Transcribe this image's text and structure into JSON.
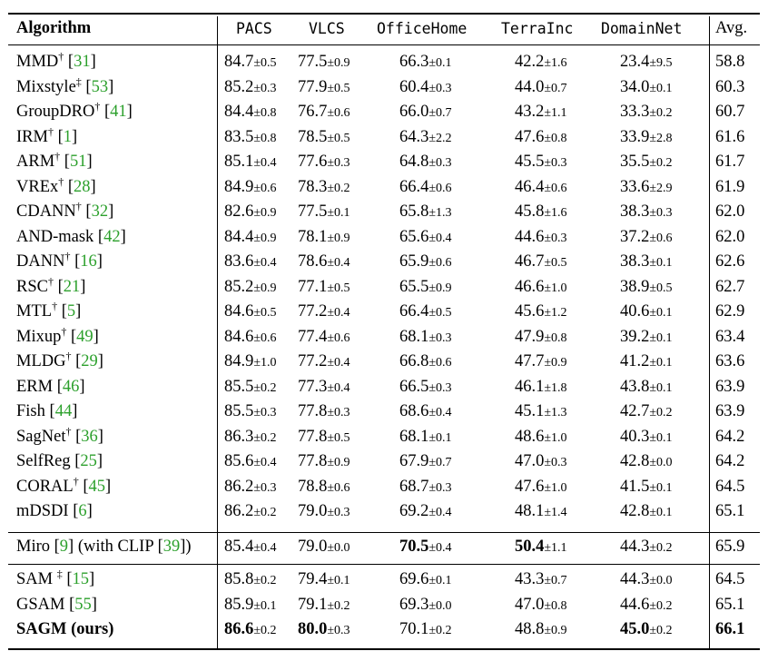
{
  "headers": {
    "algorithm": "Algorithm",
    "pacs": "PACS",
    "vlcs": "VLCS",
    "officehome": "OfficeHome",
    "terrainc": "TerraInc",
    "domainnet": "DomainNet",
    "avg": "Avg."
  },
  "rows": [
    {
      "name": "MMD",
      "sup": "†",
      "ref": "31",
      "pacs": [
        "84.7",
        "±0.5"
      ],
      "vlcs": [
        "77.5",
        "±0.9"
      ],
      "officehome": [
        "66.3",
        "±0.1"
      ],
      "terrainc": [
        "42.2",
        "±1.6"
      ],
      "domainnet": [
        "23.4",
        "±9.5"
      ],
      "avg": "58.8"
    },
    {
      "name": "Mixstyle",
      "sup": "‡",
      "ref": "53",
      "pacs": [
        "85.2",
        "±0.3"
      ],
      "vlcs": [
        "77.9",
        "±0.5"
      ],
      "officehome": [
        "60.4",
        "±0.3"
      ],
      "terrainc": [
        "44.0",
        "±0.7"
      ],
      "domainnet": [
        "34.0",
        "±0.1"
      ],
      "avg": "60.3"
    },
    {
      "name": "GroupDRO",
      "sup": "†",
      "ref": "41",
      "pacs": [
        "84.4",
        "±0.8"
      ],
      "vlcs": [
        "76.7",
        "±0.6"
      ],
      "officehome": [
        "66.0",
        "±0.7"
      ],
      "terrainc": [
        "43.2",
        "±1.1"
      ],
      "domainnet": [
        "33.3",
        "±0.2"
      ],
      "avg": "60.7"
    },
    {
      "name": "IRM",
      "sup": "†",
      "ref": "1",
      "pacs": [
        "83.5",
        "±0.8"
      ],
      "vlcs": [
        "78.5",
        "±0.5"
      ],
      "officehome": [
        "64.3",
        "±2.2"
      ],
      "terrainc": [
        "47.6",
        "±0.8"
      ],
      "domainnet": [
        "33.9",
        "±2.8"
      ],
      "avg": "61.6"
    },
    {
      "name": "ARM",
      "sup": "†",
      "ref": "51",
      "pacs": [
        "85.1",
        "±0.4"
      ],
      "vlcs": [
        "77.6",
        "±0.3"
      ],
      "officehome": [
        "64.8",
        "±0.3"
      ],
      "terrainc": [
        "45.5",
        "±0.3"
      ],
      "domainnet": [
        "35.5",
        "±0.2"
      ],
      "avg": "61.7"
    },
    {
      "name": "VREx",
      "sup": "†",
      "ref": "28",
      "pacs": [
        "84.9",
        "±0.6"
      ],
      "vlcs": [
        "78.3",
        "±0.2"
      ],
      "officehome": [
        "66.4",
        "±0.6"
      ],
      "terrainc": [
        "46.4",
        "±0.6"
      ],
      "domainnet": [
        "33.6",
        "±2.9"
      ],
      "avg": "61.9"
    },
    {
      "name": "CDANN",
      "sup": "†",
      "ref": "32",
      "pacs": [
        "82.6",
        "±0.9"
      ],
      "vlcs": [
        "77.5",
        "±0.1"
      ],
      "officehome": [
        "65.8",
        "±1.3"
      ],
      "terrainc": [
        "45.8",
        "±1.6"
      ],
      "domainnet": [
        "38.3",
        "±0.3"
      ],
      "avg": "62.0"
    },
    {
      "name": "AND-mask",
      "sup": "",
      "ref": "42",
      "pacs": [
        "84.4",
        "±0.9"
      ],
      "vlcs": [
        "78.1",
        "±0.9"
      ],
      "officehome": [
        "65.6",
        "±0.4"
      ],
      "terrainc": [
        "44.6",
        "±0.3"
      ],
      "domainnet": [
        "37.2",
        "±0.6"
      ],
      "avg": "62.0"
    },
    {
      "name": "DANN",
      "sup": "†",
      "ref": "16",
      "pacs": [
        "83.6",
        "±0.4"
      ],
      "vlcs": [
        "78.6",
        "±0.4"
      ],
      "officehome": [
        "65.9",
        "±0.6"
      ],
      "terrainc": [
        "46.7",
        "±0.5"
      ],
      "domainnet": [
        "38.3",
        "±0.1"
      ],
      "avg": "62.6"
    },
    {
      "name": "RSC",
      "sup": "†",
      "ref": "21",
      "pacs": [
        "85.2",
        "±0.9"
      ],
      "vlcs": [
        "77.1",
        "±0.5"
      ],
      "officehome": [
        "65.5",
        "±0.9"
      ],
      "terrainc": [
        "46.6",
        "±1.0"
      ],
      "domainnet": [
        "38.9",
        "±0.5"
      ],
      "avg": "62.7"
    },
    {
      "name": "MTL",
      "sup": "†",
      "ref": "5",
      "pacs": [
        "84.6",
        "±0.5"
      ],
      "vlcs": [
        "77.2",
        "±0.4"
      ],
      "officehome": [
        "66.4",
        "±0.5"
      ],
      "terrainc": [
        "45.6",
        "±1.2"
      ],
      "domainnet": [
        "40.6",
        "±0.1"
      ],
      "avg": "62.9"
    },
    {
      "name": "Mixup",
      "sup": "†",
      "ref": "49",
      "pacs": [
        "84.6",
        "±0.6"
      ],
      "vlcs": [
        "77.4",
        "±0.6"
      ],
      "officehome": [
        "68.1",
        "±0.3"
      ],
      "terrainc": [
        "47.9",
        "±0.8"
      ],
      "domainnet": [
        "39.2",
        "±0.1"
      ],
      "avg": "63.4"
    },
    {
      "name": "MLDG",
      "sup": "†",
      "ref": "29",
      "pacs": [
        "84.9",
        "±1.0"
      ],
      "vlcs": [
        "77.2",
        "±0.4"
      ],
      "officehome": [
        "66.8",
        "±0.6"
      ],
      "terrainc": [
        "47.7",
        "±0.9"
      ],
      "domainnet": [
        "41.2",
        "±0.1"
      ],
      "avg": "63.6"
    },
    {
      "name": "ERM",
      "sup": "",
      "ref": "46",
      "pacs": [
        "85.5",
        "±0.2"
      ],
      "vlcs": [
        "77.3",
        "±0.4"
      ],
      "officehome": [
        "66.5",
        "±0.3"
      ],
      "terrainc": [
        "46.1",
        "±1.8"
      ],
      "domainnet": [
        "43.8",
        "±0.1"
      ],
      "avg": "63.9"
    },
    {
      "name": "Fish",
      "sup": "",
      "ref": "44",
      "pacs": [
        "85.5",
        "±0.3"
      ],
      "vlcs": [
        "77.8",
        "±0.3"
      ],
      "officehome": [
        "68.6",
        "±0.4"
      ],
      "terrainc": [
        "45.1",
        "±1.3"
      ],
      "domainnet": [
        "42.7",
        "±0.2"
      ],
      "avg": "63.9"
    },
    {
      "name": "SagNet",
      "sup": "†",
      "ref": "36",
      "pacs": [
        "86.3",
        "±0.2"
      ],
      "vlcs": [
        "77.8",
        "±0.5"
      ],
      "officehome": [
        "68.1",
        "±0.1"
      ],
      "terrainc": [
        "48.6",
        "±1.0"
      ],
      "domainnet": [
        "40.3",
        "±0.1"
      ],
      "avg": "64.2"
    },
    {
      "name": "SelfReg",
      "sup": "",
      "ref": "25",
      "pacs": [
        "85.6",
        "±0.4"
      ],
      "vlcs": [
        "77.8",
        "±0.9"
      ],
      "officehome": [
        "67.9",
        "±0.7"
      ],
      "terrainc": [
        "47.0",
        "±0.3"
      ],
      "domainnet": [
        "42.8",
        "±0.0"
      ],
      "avg": "64.2"
    },
    {
      "name": "CORAL",
      "sup": "†",
      "ref": "45",
      "pacs": [
        "86.2",
        "±0.3"
      ],
      "vlcs": [
        "78.8",
        "±0.6"
      ],
      "officehome": [
        "68.7",
        "±0.3"
      ],
      "terrainc": [
        "47.6",
        "±1.0"
      ],
      "domainnet": [
        "41.5",
        "±0.1"
      ],
      "avg": "64.5"
    },
    {
      "name": "mDSDI",
      "sup": "",
      "ref": "6",
      "pacs": [
        "86.2",
        "±0.2"
      ],
      "vlcs": [
        "79.0",
        "±0.3"
      ],
      "officehome": [
        "69.2",
        "±0.4"
      ],
      "terrainc": [
        "48.1",
        "±1.4"
      ],
      "domainnet": [
        "42.8",
        "±0.1"
      ],
      "avg": "65.1"
    }
  ],
  "miro": {
    "name_a": "Miro",
    "ref_a": "9",
    "name_b": "(with CLIP",
    "ref_b": "39",
    "name_c": ")",
    "pacs": [
      "85.4",
      "±0.4"
    ],
    "vlcs": [
      "79.0",
      "±0.0"
    ],
    "officehome": [
      "70.5",
      "±0.4"
    ],
    "terrainc": [
      "50.4",
      "±1.1"
    ],
    "domainnet": [
      "44.3",
      "±0.2"
    ],
    "avg": "65.9"
  },
  "sam_rows": [
    {
      "name": "SAM ",
      "sup": "‡",
      "ref": "15",
      "pacs": [
        "85.8",
        "±0.2"
      ],
      "vlcs": [
        "79.4",
        "±0.1"
      ],
      "officehome": [
        "69.6",
        "±0.1"
      ],
      "terrainc": [
        "43.3",
        "±0.7"
      ],
      "domainnet": [
        "44.3",
        "±0.0"
      ],
      "avg": "64.5"
    },
    {
      "name": "GSAM",
      "sup": "",
      "ref": "55",
      "pacs": [
        "85.9",
        "±0.1"
      ],
      "vlcs": [
        "79.1",
        "±0.2"
      ],
      "officehome": [
        "69.3",
        "±0.0"
      ],
      "terrainc": [
        "47.0",
        "±0.8"
      ],
      "domainnet": [
        "44.6",
        "±0.2"
      ],
      "avg": "65.1"
    }
  ],
  "sagm": {
    "name": "SAGM (ours)",
    "pacs": [
      "86.6",
      "±0.2"
    ],
    "vlcs": [
      "80.0",
      "±0.3"
    ],
    "officehome": [
      "70.1",
      "±0.2"
    ],
    "terrainc": [
      "48.8",
      "±0.9"
    ],
    "domainnet": [
      "45.0",
      "±0.2"
    ],
    "avg": "66.1"
  },
  "colors": {
    "citation": "#2ca02c",
    "text": "#000000"
  }
}
